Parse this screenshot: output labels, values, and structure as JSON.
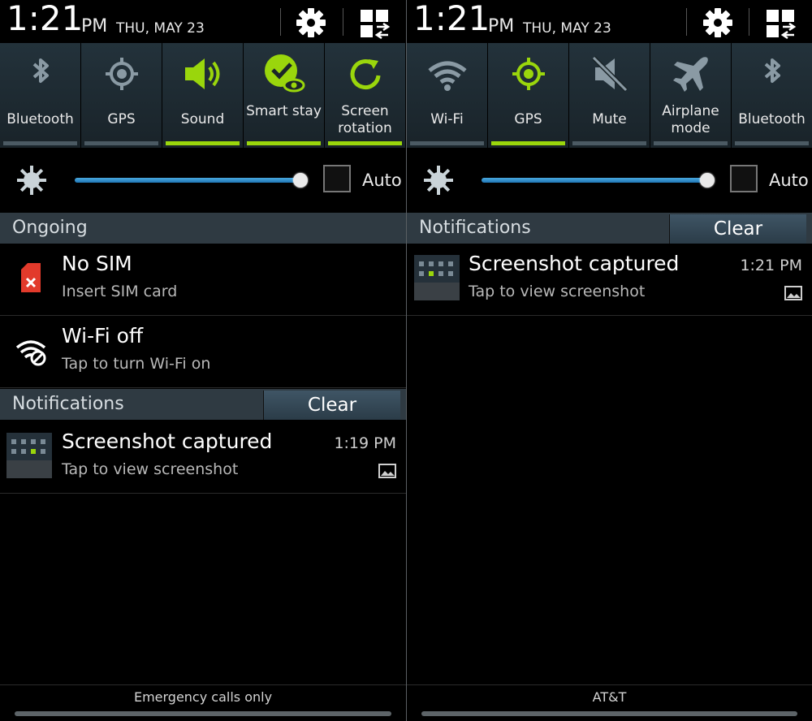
{
  "left": {
    "status": {
      "time": "1:21",
      "ampm": "PM",
      "date": "THU, MAY 23"
    },
    "quick_settings": [
      {
        "label": "Bluetooth",
        "icon": "bluetooth-icon",
        "on": false
      },
      {
        "label": "GPS",
        "icon": "gps-icon",
        "on": false
      },
      {
        "label": "Sound",
        "icon": "sound-icon",
        "on": true
      },
      {
        "label": "Smart stay",
        "icon": "smart-stay-icon",
        "on": true
      },
      {
        "label": "Screen rotation",
        "icon": "screen-rotation-icon",
        "on": true
      }
    ],
    "brightness": {
      "level": 0.96,
      "auto_label": "Auto",
      "auto_checked": false
    },
    "ongoing_header": "Ongoing",
    "ongoing": [
      {
        "title": "No SIM",
        "subtitle": "Insert SIM card",
        "icon": "no-sim-icon"
      },
      {
        "title": "Wi-Fi off",
        "subtitle": "Tap to turn Wi-Fi on",
        "icon": "wifi-off-icon"
      }
    ],
    "notifications_header": "Notifications",
    "clear_label": "Clear",
    "notifications": [
      {
        "title": "Screenshot captured",
        "subtitle": "Tap to view screenshot",
        "time": "1:19 PM",
        "icon": "gallery-icon"
      }
    ],
    "carrier": "Emergency calls only"
  },
  "right": {
    "status": {
      "time": "1:21",
      "ampm": "PM",
      "date": "THU, MAY 23"
    },
    "quick_settings": [
      {
        "label": "Wi-Fi",
        "icon": "wifi-icon",
        "on": false
      },
      {
        "label": "GPS",
        "icon": "gps-icon",
        "on": true
      },
      {
        "label": "Mute",
        "icon": "mute-icon",
        "on": false
      },
      {
        "label": "Airplane mode",
        "icon": "airplane-icon",
        "on": false
      },
      {
        "label": "Bluetooth",
        "icon": "bluetooth-icon",
        "on": false
      }
    ],
    "brightness": {
      "level": 0.96,
      "auto_label": "Auto",
      "auto_checked": false
    },
    "notifications_header": "Notifications",
    "clear_label": "Clear",
    "notifications": [
      {
        "title": "Screenshot captured",
        "subtitle": "Tap to view screenshot",
        "time": "1:21 PM",
        "icon": "gallery-icon"
      }
    ],
    "carrier": "AT&T"
  },
  "colors": {
    "accent_green": "#9ad60c",
    "inactive_grey": "#8a9aa4",
    "slider_blue": "#3b9bd8"
  }
}
